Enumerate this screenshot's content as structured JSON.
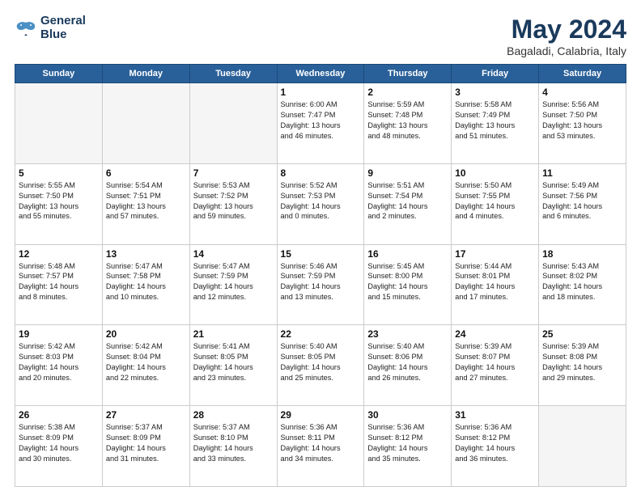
{
  "logo": {
    "line1": "General",
    "line2": "Blue"
  },
  "title": "May 2024",
  "subtitle": "Bagaladi, Calabria, Italy",
  "days_of_week": [
    "Sunday",
    "Monday",
    "Tuesday",
    "Wednesday",
    "Thursday",
    "Friday",
    "Saturday"
  ],
  "weeks": [
    [
      {
        "day": "",
        "info": ""
      },
      {
        "day": "",
        "info": ""
      },
      {
        "day": "",
        "info": ""
      },
      {
        "day": "1",
        "info": "Sunrise: 6:00 AM\nSunset: 7:47 PM\nDaylight: 13 hours\nand 46 minutes."
      },
      {
        "day": "2",
        "info": "Sunrise: 5:59 AM\nSunset: 7:48 PM\nDaylight: 13 hours\nand 48 minutes."
      },
      {
        "day": "3",
        "info": "Sunrise: 5:58 AM\nSunset: 7:49 PM\nDaylight: 13 hours\nand 51 minutes."
      },
      {
        "day": "4",
        "info": "Sunrise: 5:56 AM\nSunset: 7:50 PM\nDaylight: 13 hours\nand 53 minutes."
      }
    ],
    [
      {
        "day": "5",
        "info": "Sunrise: 5:55 AM\nSunset: 7:50 PM\nDaylight: 13 hours\nand 55 minutes."
      },
      {
        "day": "6",
        "info": "Sunrise: 5:54 AM\nSunset: 7:51 PM\nDaylight: 13 hours\nand 57 minutes."
      },
      {
        "day": "7",
        "info": "Sunrise: 5:53 AM\nSunset: 7:52 PM\nDaylight: 13 hours\nand 59 minutes."
      },
      {
        "day": "8",
        "info": "Sunrise: 5:52 AM\nSunset: 7:53 PM\nDaylight: 14 hours\nand 0 minutes."
      },
      {
        "day": "9",
        "info": "Sunrise: 5:51 AM\nSunset: 7:54 PM\nDaylight: 14 hours\nand 2 minutes."
      },
      {
        "day": "10",
        "info": "Sunrise: 5:50 AM\nSunset: 7:55 PM\nDaylight: 14 hours\nand 4 minutes."
      },
      {
        "day": "11",
        "info": "Sunrise: 5:49 AM\nSunset: 7:56 PM\nDaylight: 14 hours\nand 6 minutes."
      }
    ],
    [
      {
        "day": "12",
        "info": "Sunrise: 5:48 AM\nSunset: 7:57 PM\nDaylight: 14 hours\nand 8 minutes."
      },
      {
        "day": "13",
        "info": "Sunrise: 5:47 AM\nSunset: 7:58 PM\nDaylight: 14 hours\nand 10 minutes."
      },
      {
        "day": "14",
        "info": "Sunrise: 5:47 AM\nSunset: 7:59 PM\nDaylight: 14 hours\nand 12 minutes."
      },
      {
        "day": "15",
        "info": "Sunrise: 5:46 AM\nSunset: 7:59 PM\nDaylight: 14 hours\nand 13 minutes."
      },
      {
        "day": "16",
        "info": "Sunrise: 5:45 AM\nSunset: 8:00 PM\nDaylight: 14 hours\nand 15 minutes."
      },
      {
        "day": "17",
        "info": "Sunrise: 5:44 AM\nSunset: 8:01 PM\nDaylight: 14 hours\nand 17 minutes."
      },
      {
        "day": "18",
        "info": "Sunrise: 5:43 AM\nSunset: 8:02 PM\nDaylight: 14 hours\nand 18 minutes."
      }
    ],
    [
      {
        "day": "19",
        "info": "Sunrise: 5:42 AM\nSunset: 8:03 PM\nDaylight: 14 hours\nand 20 minutes."
      },
      {
        "day": "20",
        "info": "Sunrise: 5:42 AM\nSunset: 8:04 PM\nDaylight: 14 hours\nand 22 minutes."
      },
      {
        "day": "21",
        "info": "Sunrise: 5:41 AM\nSunset: 8:05 PM\nDaylight: 14 hours\nand 23 minutes."
      },
      {
        "day": "22",
        "info": "Sunrise: 5:40 AM\nSunset: 8:05 PM\nDaylight: 14 hours\nand 25 minutes."
      },
      {
        "day": "23",
        "info": "Sunrise: 5:40 AM\nSunset: 8:06 PM\nDaylight: 14 hours\nand 26 minutes."
      },
      {
        "day": "24",
        "info": "Sunrise: 5:39 AM\nSunset: 8:07 PM\nDaylight: 14 hours\nand 27 minutes."
      },
      {
        "day": "25",
        "info": "Sunrise: 5:39 AM\nSunset: 8:08 PM\nDaylight: 14 hours\nand 29 minutes."
      }
    ],
    [
      {
        "day": "26",
        "info": "Sunrise: 5:38 AM\nSunset: 8:09 PM\nDaylight: 14 hours\nand 30 minutes."
      },
      {
        "day": "27",
        "info": "Sunrise: 5:37 AM\nSunset: 8:09 PM\nDaylight: 14 hours\nand 31 minutes."
      },
      {
        "day": "28",
        "info": "Sunrise: 5:37 AM\nSunset: 8:10 PM\nDaylight: 14 hours\nand 33 minutes."
      },
      {
        "day": "29",
        "info": "Sunrise: 5:36 AM\nSunset: 8:11 PM\nDaylight: 14 hours\nand 34 minutes."
      },
      {
        "day": "30",
        "info": "Sunrise: 5:36 AM\nSunset: 8:12 PM\nDaylight: 14 hours\nand 35 minutes."
      },
      {
        "day": "31",
        "info": "Sunrise: 5:36 AM\nSunset: 8:12 PM\nDaylight: 14 hours\nand 36 minutes."
      },
      {
        "day": "",
        "info": ""
      }
    ]
  ]
}
